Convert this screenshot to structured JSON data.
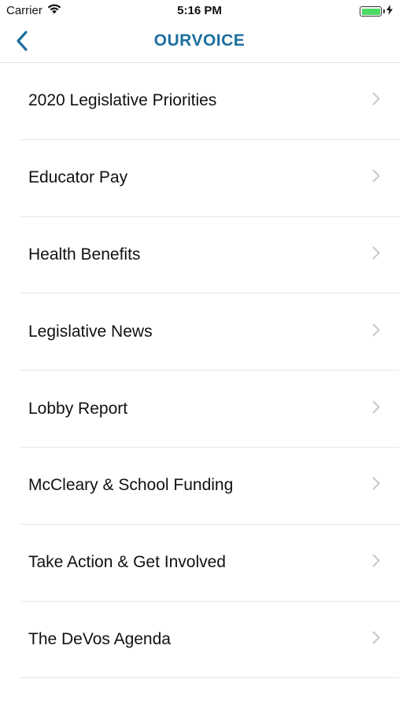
{
  "status_bar": {
    "carrier": "Carrier",
    "time": "5:16 PM",
    "battery_level": 1.0,
    "battery_color": "#4cd964"
  },
  "nav": {
    "back_icon": "chevron-left-icon",
    "title": "OURVOICE",
    "title_color": "#1c6f9e"
  },
  "menu": {
    "items": [
      {
        "label": "2020 Legislative Priorities"
      },
      {
        "label": "Educator Pay"
      },
      {
        "label": "Health Benefits"
      },
      {
        "label": "Legislative News"
      },
      {
        "label": "Lobby Report"
      },
      {
        "label": "McCleary & School Funding"
      },
      {
        "label": "Take Action & Get Involved"
      },
      {
        "label": "The DeVos Agenda"
      }
    ],
    "chevron_icon": "chevron-right-icon"
  }
}
